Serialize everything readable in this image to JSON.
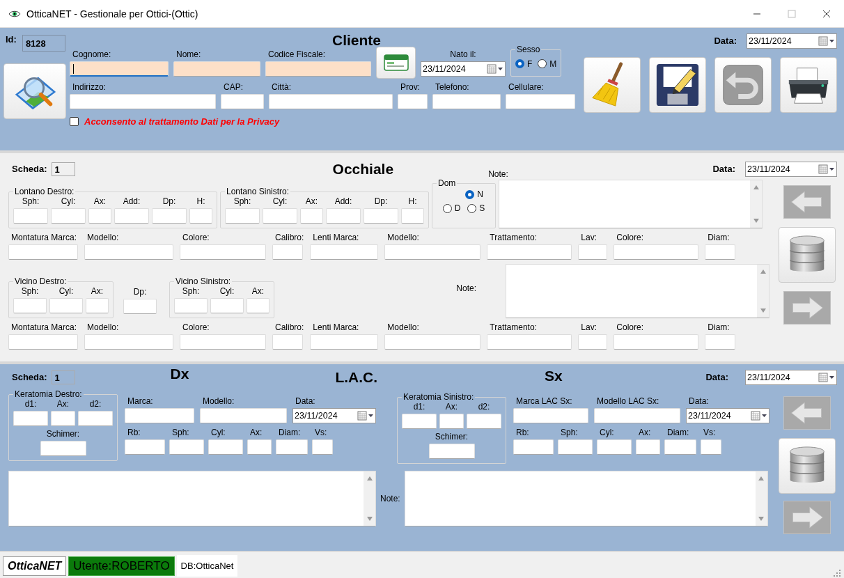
{
  "window": {
    "title": "OtticaNET - Gestionale per Ottici-(Ottic)"
  },
  "cliente": {
    "title": "Cliente",
    "id_label": "Id:",
    "id": "8128",
    "data_label": "Data:",
    "data": "23/11/2024",
    "row1": [
      {
        "label": "Cognome:",
        "highlighted": true,
        "focused": true
      },
      {
        "label": "Nome:",
        "highlighted": true,
        "focused": false
      },
      {
        "label": "Codice Fiscale:",
        "highlighted": true,
        "focused": false
      }
    ],
    "nato_label": "Nato il:",
    "nato": "23/11/2024",
    "sesso": {
      "title": "Sesso",
      "options": [
        {
          "label": "F",
          "selected": true
        },
        {
          "label": "M",
          "selected": false
        }
      ]
    },
    "row2": [
      "Indirizzo:",
      "CAP:",
      "Città:",
      "Prov:",
      "Telefono:",
      "Cellulare:"
    ],
    "privacy": {
      "label": "Acconsento al trattamento Dati per la Privacy",
      "checked": false
    }
  },
  "occhiale": {
    "scheda_label": "Scheda:",
    "scheda": "1",
    "title": "Occhiale",
    "note_label": "Note:",
    "data_label": "Data:",
    "data": "23/11/2024",
    "lontano_destro": {
      "title": "Lontano Destro:",
      "fields": [
        "Sph:",
        "Cyl:",
        "Ax:",
        "Add:",
        "Dp:",
        "H:"
      ]
    },
    "lontano_sinistro": {
      "title": "Lontano Sinistro:",
      "fields": [
        "Sph:",
        "Cyl:",
        "Ax:",
        "Add:",
        "Dp:",
        "H:"
      ]
    },
    "dom": {
      "title": "Dom",
      "options": [
        {
          "label": "N",
          "selected": true
        },
        {
          "label": "D",
          "selected": false
        },
        {
          "label": "S",
          "selected": false
        }
      ]
    },
    "montatura_1": [
      "Montatura Marca:",
      "Modello:",
      "Colore:",
      "Calibro:",
      "Lenti Marca:",
      "Modello:",
      "Trattamento:",
      "Lav:",
      "Colore:",
      "Diam:"
    ],
    "vicino_destro": {
      "title": "Vicino Destro:",
      "fields": [
        "Sph:",
        "Cyl:",
        "Ax:"
      ]
    },
    "vicino_dp": "Dp:",
    "vicino_sinistro": {
      "title": "Vicino Sinistro:",
      "fields": [
        "Sph:",
        "Cyl:",
        "Ax:"
      ]
    },
    "note_label_2": "Note:",
    "montatura_2": [
      "Montatura Marca:",
      "Modello:",
      "Colore:",
      "Calibro:",
      "Lenti Marca:",
      "Modello:",
      "Trattamento:",
      "Lav:",
      "Colore:",
      "Diam:"
    ]
  },
  "lac": {
    "scheda_label": "Scheda:",
    "scheda": "1",
    "dx_title": "Dx",
    "title": "L.A.C.",
    "sx_title": "Sx",
    "data_label": "Data:",
    "data": "23/11/2024",
    "keratomia_destro": {
      "title": "Keratomia Destro:",
      "fields": [
        "d1:",
        "Ax:",
        "d2:"
      ],
      "schimer": "Schimer:"
    },
    "dx": {
      "row1": [
        "Marca:",
        "Modello:"
      ],
      "data_label": "Data:",
      "data": "23/11/2024",
      "row2": [
        "Rb:",
        "Sph:",
        "Cyl:",
        "Ax:",
        "Diam:",
        "Vs:"
      ]
    },
    "keratomia_sinistro": {
      "title": "Keratomia Sinistro:",
      "fields": [
        "d1:",
        "Ax:",
        "d2:"
      ],
      "schimer": "Schimer:"
    },
    "sx": {
      "row1": [
        "Marca LAC Sx:",
        "Modello LAC Sx:"
      ],
      "data_label": "Data:",
      "data": "23/11/2024",
      "row2": [
        "Rb:",
        "Sph:",
        "Cyl:",
        "Ax:",
        "Diam:",
        "Vs:"
      ]
    },
    "note_label": "Note:"
  },
  "status_bar": {
    "app": "OtticaNET",
    "user": "Utente:ROBERTO",
    "db": "DB:OtticaNet"
  }
}
